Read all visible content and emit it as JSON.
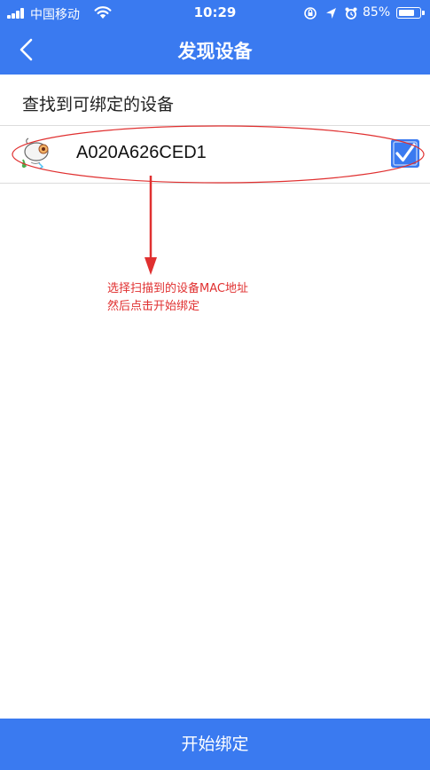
{
  "status_bar": {
    "carrier": "中国移动",
    "time": "10:29",
    "battery_percent": "85%",
    "battery_level": 0.85,
    "icons": [
      "signal-icon",
      "wifi-icon",
      "orientation-lock-icon",
      "location-icon",
      "alarm-icon",
      "battery-icon"
    ]
  },
  "header": {
    "title": "发现设备",
    "back_icon": "chevron-left-icon"
  },
  "section": {
    "label": "查找到可绑定的设备"
  },
  "devices": [
    {
      "mac": "A020A626CED1",
      "checked": true,
      "icon": "device-cartoon-icon"
    }
  ],
  "annotation": {
    "line1": "选择扫描到的设备MAC地址",
    "line2": "然后点击开始绑定",
    "color": "#e03030"
  },
  "footer": {
    "button_label": "开始绑定"
  },
  "colors": {
    "primary": "#3a7af0",
    "annotation_red": "#e03030"
  }
}
